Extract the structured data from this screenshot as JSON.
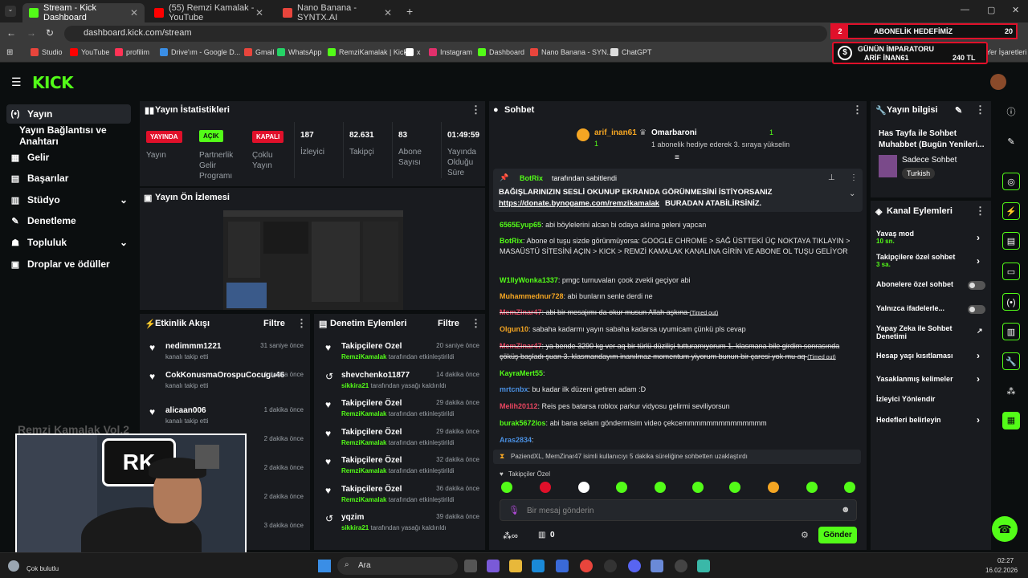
{
  "browser": {
    "tabs": [
      {
        "title": "Stream - Kick Dashboard",
        "color": "#53fc18"
      },
      {
        "title": "(55) Remzi Kamalak - YouTube",
        "color": "#ff0000"
      },
      {
        "title": "Nano Banana - SYNTX.AI",
        "color": "#e8453c"
      }
    ],
    "url": "dashboard.kick.com/stream",
    "bookmarks": [
      "Studio",
      "YouTube",
      "profilim",
      "Drive'ım - Google D...",
      "Gmail",
      "WhatsApp",
      "RemziKamalak | Kick",
      "x",
      "Instagram",
      "Dashboard",
      "Nano Banana - SYN...",
      "ChatGPT"
    ],
    "other_bookmarks": "Yer İşaretleri"
  },
  "overlay": {
    "goal_label": "ABONELİK HEDEFİMİZ",
    "goal_current": "2",
    "goal_target": "20",
    "emperor_title": "GÜNÜN İMPARATORU",
    "emperor_name": "ARİF İNAN61",
    "emperor_amount": "240 TL"
  },
  "sidebar": {
    "items": [
      {
        "label": "Yayın",
        "icon": "(•)"
      },
      {
        "label": "Yayın Bağlantısı ve Anahtarı",
        "icon": ""
      },
      {
        "label": "Gelir",
        "icon": "▦"
      },
      {
        "label": "Başarılar",
        "icon": "▤"
      },
      {
        "label": "Stüdyo",
        "icon": "▥"
      },
      {
        "label": "Denetleme",
        "icon": "✎"
      },
      {
        "label": "Topluluk",
        "icon": "☗"
      },
      {
        "label": "Droplar ve ödüller",
        "icon": "▣"
      }
    ]
  },
  "stats": {
    "title": "Yayın İstatistikleri",
    "badges": [
      {
        "badge": "YAYINDA",
        "label": "Yayın",
        "color": "#e0102a"
      },
      {
        "badge": "AÇIK",
        "label": "Partnerlik Gelir Programı",
        "color": "#53fc18"
      },
      {
        "badge": "KAPALI",
        "label": "Çoklu Yayın",
        "color": "#e0102a"
      }
    ],
    "numbers": [
      {
        "value": "187",
        "label": "İzleyici"
      },
      {
        "value": "82.631",
        "label": "Takipçi"
      },
      {
        "value": "83",
        "label": "Abone Sayısı"
      },
      {
        "value": "01:49:59",
        "label": "Yayında Olduğu Süre"
      }
    ]
  },
  "preview": {
    "title": "Yayın Ön İzlemesi"
  },
  "activity": {
    "title": "Etkinlik Akışı",
    "filter": "Filtre",
    "items": [
      {
        "user": "nedimmm1221",
        "action": "kanalı takip etti",
        "time": "31 saniye önce"
      },
      {
        "user": "CokKonusmaOrospuCocugu46",
        "action": "kanalı takip etti",
        "time": "1 dakika önce"
      },
      {
        "user": "alicaan006",
        "action": "kanalı takip etti",
        "time": "1 dakika önce"
      },
      {
        "user": "",
        "action": "",
        "time": "2 dakika önce"
      },
      {
        "user": "",
        "action": "",
        "time": "2 dakika önce"
      },
      {
        "user": "",
        "action": "",
        "time": "2 dakika önce"
      },
      {
        "user": "",
        "action": "",
        "time": "3 dakika önce"
      }
    ]
  },
  "moderation": {
    "title": "Denetim Eylemleri",
    "filter": "Filtre",
    "items": [
      {
        "title": "Takipçilere Özel",
        "by": "RemziKamalak",
        "rest": "tarafından etkinleştirildi",
        "time": "20 saniye önce",
        "icon": "♥"
      },
      {
        "title": "shevchenko11877",
        "by": "sikkira21",
        "rest": "tarafından yasağı kaldırıldı",
        "time": "14 dakika önce",
        "icon": "↺"
      },
      {
        "title": "Takipçilere Özel",
        "by": "RemziKamalak",
        "rest": "tarafından etkinleştirildi",
        "time": "29 dakika önce",
        "icon": "♥"
      },
      {
        "title": "Takipçilere Özel",
        "by": "RemziKamalak",
        "rest": "tarafından etkinleştirildi",
        "time": "29 dakika önce",
        "icon": "♥"
      },
      {
        "title": "Takipçilere Özel",
        "by": "RemziKamalak",
        "rest": "tarafından etkinleştirildi",
        "time": "32 dakika önce",
        "icon": "♥"
      },
      {
        "title": "Takipçilere Özel",
        "by": "RemziKamalak",
        "rest": "tarafından etkinleştirildi",
        "time": "36 dakika önce",
        "icon": "♥"
      },
      {
        "title": "yqzim",
        "by": "sikkira21",
        "rest": "tarafından yasağı kaldırıldı",
        "time": "39 dakika önce",
        "icon": "↺"
      }
    ]
  },
  "chat": {
    "title": "Sohbet",
    "top_gifter": "arif_inan61",
    "top_gifter_count": "1",
    "gift_user": "Omarbaroni",
    "gift_count": "1",
    "gift_text": "1 abonelik hediye ederek 3. sıraya yükselin",
    "pinned_by": "BotRix",
    "pinned_by_rest": "tarafından sabitlendi",
    "pinned_line1": "BAĞIŞLARINIZIN SESLİ OKUNUP EKRANDA GÖRÜNMESİNİ İSTİYORSANIZ",
    "pinned_link": "https://donate.bynogame.com/remzikamalak",
    "pinned_line2": "BURADAN ATABİLİRSİNİZ.",
    "messages": [
      {
        "user": "6565Eyup65",
        "color": "#53fc18",
        "text": "abi böylelerini alcan bi odaya aklına geleni yapcan"
      },
      {
        "user": "BotRix",
        "color": "#53fc18",
        "text": "Abone ol tuşu sizde görünmüyorsa: GOOGLE CHROME > SAĞ ÜSTTEKİ ÜÇ NOKTAYA TIKLAYIN > MASAÜSTÜ SİTESİNİ AÇIN > KICK > REMZİ KAMALAK KANALINA GİRİN VE ABONE OL TUŞU GELİYOR"
      },
      {
        "user": "W1llyWonka1337",
        "color": "#53fc18",
        "text": "pmgc turnuvaları çook zvekli geçiyor abi"
      },
      {
        "user": "Muhammednur728",
        "color": "#f5a623",
        "text": "abi bunların senle derdi ne"
      },
      {
        "user": "MemZinar47",
        "color": "#e94560",
        "text": "abi bir mesajımı da okur musun Allah aşkına",
        "note": "(Timed out)"
      },
      {
        "user": "Olgun10",
        "color": "#f5a623",
        "text": "sabaha kadarmı yayın sabaha kadarsa uyumicam çünkü pls cevap"
      },
      {
        "user": "MemZinar47",
        "color": "#e94560",
        "text": "ya bende 3290 kg ver aq bir türlü düzilişi tutturamıyorum 1. klasmana bile girdim sonrasında çöküş başladı şuan 3. klasmandayım inanılmaz momentum yiyorum bunun bir çaresi yok mu aq",
        "note": "(Timed out)"
      },
      {
        "user": "KayraMert55",
        "color": "#53fc18",
        "text": ""
      },
      {
        "user": "mrtcnbx",
        "color": "#4a90e2",
        "text": "bu kadar ilk düzeni getiren adam :D"
      },
      {
        "user": "Melih20112",
        "color": "#e94560",
        "text": "Reis pes batarsa roblox parkur vidyosu gelirmi seviliyorsun"
      },
      {
        "user": "burak5672los",
        "color": "#53fc18",
        "text": "abi bana selam göndermisim video çekcemmmmmmmmmmmmmm"
      },
      {
        "user": "Aras2834",
        "color": "#4a90e2",
        "text": ""
      }
    ],
    "system": "PaziendXL, MemZinar47 isimli kullanıcıyı 5 dakika süreliğine sohbetten uzaklaştırdı",
    "followers_only": "Takipçiler Özel",
    "input_placeholder": "Bir mesaj gönderin",
    "send": "Gönder",
    "points": "0"
  },
  "info": {
    "title": "Yayın bilgisi",
    "stream_title": "Has Tayfa ile Sohbet Muhabbet (Bugün Yenileri...",
    "category": "Sadece Sohbet",
    "tag": "Turkish"
  },
  "channel_actions": {
    "title": "Kanal Eylemleri",
    "items": [
      {
        "label": "Yavaş mod",
        "sub": "10 sn.",
        "ctl": "chev"
      },
      {
        "label": "Takipçilere özel sohbet",
        "sub": "3 sa.",
        "ctl": "chev"
      },
      {
        "label": "Abonelere özel sohbet",
        "sub": "",
        "ctl": "toggle"
      },
      {
        "label": "Yalnızca ifadelerle...",
        "sub": "",
        "ctl": "toggle"
      },
      {
        "label": "Yapay Zeka ile Sohbet Denetimi",
        "sub": "",
        "ctl": "ext"
      },
      {
        "label": "Hesap yaşı kısıtlaması",
        "sub": "",
        "ctl": "chev"
      },
      {
        "label": "Yasaklanmış kelimeler",
        "sub": "",
        "ctl": "chev"
      },
      {
        "label": "İzleyici Yönlendir",
        "sub": "",
        "ctl": "none"
      },
      {
        "label": "Hedefleri belirleyin",
        "sub": "",
        "ctl": "chev"
      }
    ]
  },
  "overlay_cam": {
    "name": "Remzi Kamalak Vol.2"
  },
  "taskbar": {
    "weather": "Çok bulutlu",
    "search": "Ara",
    "time": "02:27",
    "date": "16.02.2026"
  }
}
